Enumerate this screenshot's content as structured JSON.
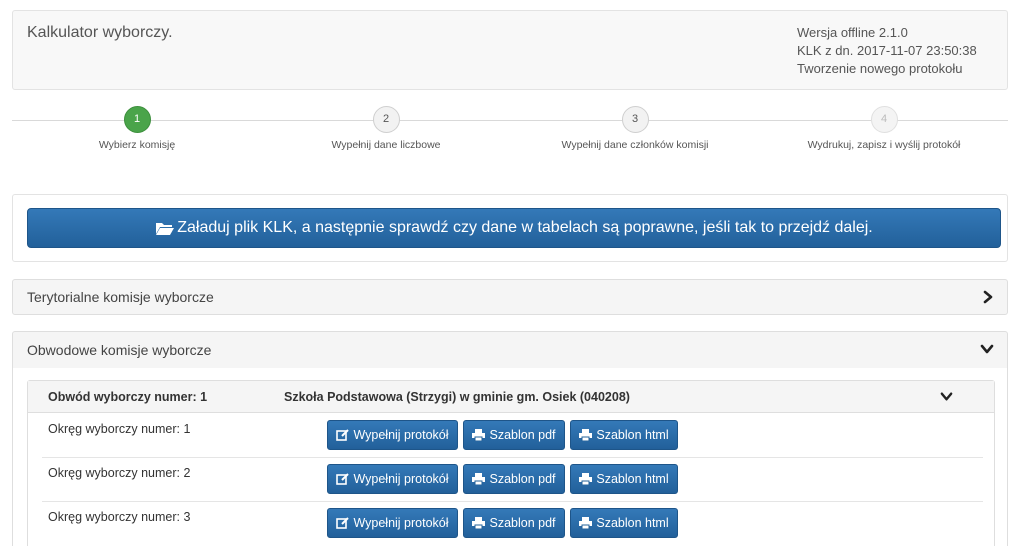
{
  "header": {
    "title": "Kalkulator wyborczy.",
    "version": "Wersja offline 2.1.0",
    "klk_date": "KLK z dn. 2017-11-07 23:50:38",
    "mode": "Tworzenie nowego protokołu"
  },
  "wizard": {
    "steps": [
      {
        "number": "1",
        "label": "Wybierz komisję",
        "state": "active"
      },
      {
        "number": "2",
        "label": "Wypełnij dane liczbowe",
        "state": "default"
      },
      {
        "number": "3",
        "label": "Wypełnij dane członków komisji",
        "state": "default"
      },
      {
        "number": "4",
        "label": "Wydrukuj, zapisz i wyślij protokół",
        "state": "disabled"
      }
    ]
  },
  "load": {
    "button_label": "Załaduj plik KLK, a następnie sprawdź czy dane w tabelach są poprawne, jeśli tak to przejdź dalej.",
    "icon": "folder-open-icon"
  },
  "panels": {
    "territorial": {
      "title": "Terytorialne komisje wyborcze",
      "state": "collapsed"
    },
    "district": {
      "title": "Obwodowe komisje wyborcze",
      "state": "expanded"
    }
  },
  "obwod": {
    "number_label": "Obwód wyborczy numer: 1",
    "name": "Szkoła Podstawowa (Strzygi) w gminie gm. Osiek (040208)",
    "rows": [
      {
        "label": "Okręg wyborczy numer: 1"
      },
      {
        "label": "Okręg wyborczy numer: 2"
      },
      {
        "label": "Okręg wyborczy numer: 3"
      }
    ],
    "buttons": {
      "fill": "Wypełnij protokół",
      "pdf": "Szablon pdf",
      "html": "Szablon html"
    }
  },
  "colors": {
    "primary": "#2a6ca8",
    "active_step": "#4aa44a"
  }
}
